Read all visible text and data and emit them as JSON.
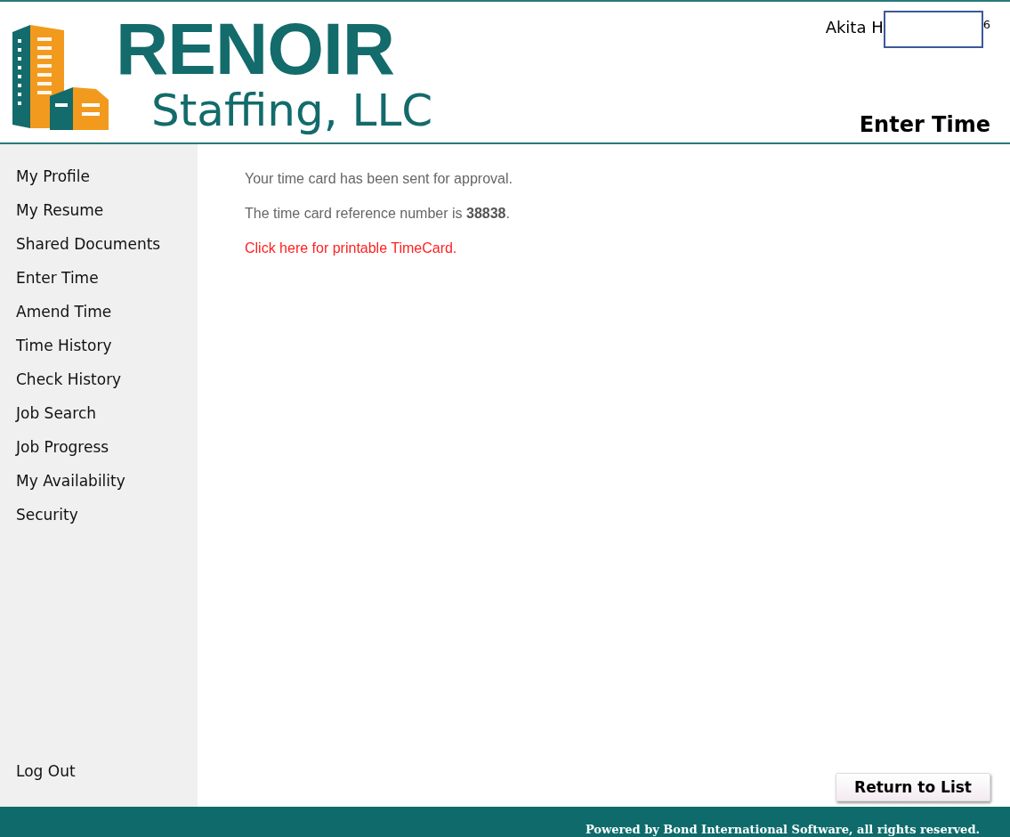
{
  "logo": {
    "name": "RENOIR",
    "tagline": "Staffing, LLC"
  },
  "user": {
    "name_start": "Akita H",
    "name_end": "6"
  },
  "page_title": "Enter Time",
  "sidebar": {
    "items": [
      {
        "label": "My Profile"
      },
      {
        "label": "My Resume"
      },
      {
        "label": "Shared Documents"
      },
      {
        "label": "Enter Time"
      },
      {
        "label": "Amend Time"
      },
      {
        "label": "Time History"
      },
      {
        "label": "Check History"
      },
      {
        "label": "Job Search"
      },
      {
        "label": "Job Progress"
      },
      {
        "label": "My Availability"
      },
      {
        "label": "Security"
      }
    ],
    "logout": "Log Out"
  },
  "messages": [
    "Your time card has been sent for approval.",
    "The time card reference number is **38838**."
  ],
  "printable_link": "Click here for printable TimeCard.",
  "return_button": "Return to List",
  "footer": "Powered by Bond International Software, all rights reserved."
}
